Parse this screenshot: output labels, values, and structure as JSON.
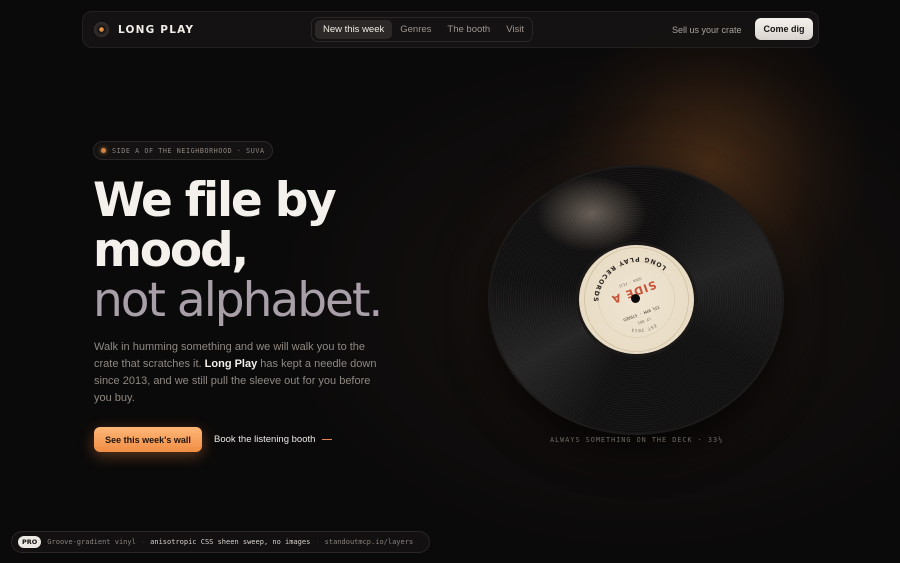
{
  "brand": {
    "name": "LONG PLAY",
    "icon": "record-icon"
  },
  "nav": {
    "tabs": [
      "New this week",
      "Genres",
      "The booth",
      "Visit"
    ],
    "active_tab": "New this week",
    "sell_link": "Sell us your crate",
    "cta": "Come dig"
  },
  "hero": {
    "eyebrow": "SIDE A OF THE NEIGHBORHOOD · SUVA",
    "headline_line1": "We file by",
    "headline_line2": "mood,",
    "headline_line3": "not alphabet.",
    "lede_pre": "Walk in humming something and we will walk you to the crate that scratches it. ",
    "lede_brand": "Long Play",
    "lede_post": " has kept a needle down since 2013, and we still pull the sleeve out for you before you buy.",
    "primary_cta": "See this week's wall",
    "secondary_cta": "Book the listening booth"
  },
  "record": {
    "label_title": "SIDE A",
    "label_ring": "LONG PLAY RECORDS",
    "label_speed": "33⅓ RPM · STEREO",
    "label_est": "EST 2013",
    "label_suva": "SUVA · FIJI",
    "label_catalog": "LP 001",
    "caption": "ALWAYS SOMETHING ON THE DECK · 33⅓"
  },
  "footer": {
    "pill": "PRO",
    "item1": "Groove-gradient vinyl",
    "item2": "anisotropic CSS sheen sweep, no images",
    "item3": "standoutmcp.io/layers"
  },
  "colors": {
    "accent": "#f08d45",
    "background": "#0b0a0a",
    "label": "#e8dcc5",
    "label_ink": "#c8553a"
  }
}
